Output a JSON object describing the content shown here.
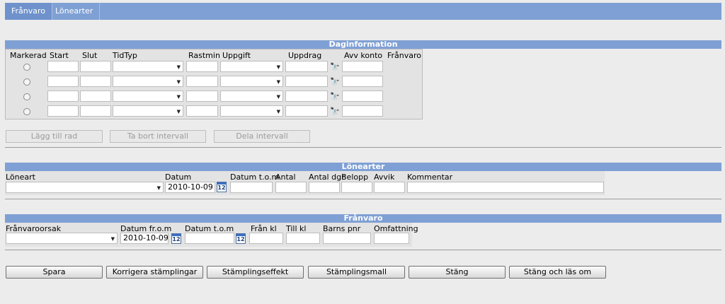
{
  "tabs": [
    "Frånvaro",
    "Lönearter"
  ],
  "daginfo": {
    "title": "Daginformation",
    "headers": [
      "Markerad",
      "Start",
      "Slut",
      "TidTyp",
      "Rastmin",
      "Uppgift",
      "Uppdrag",
      "Avv konto",
      "Frånvaro"
    ],
    "row_count": 4,
    "buttons": [
      "Lägg till rad",
      "Ta bort intervall",
      "Dela intervall"
    ]
  },
  "lonearter": {
    "title": "Lönearter",
    "headers": [
      "Löneart",
      "Datum",
      "Datum t.o.m",
      "Antal",
      "Antal dgr",
      "Belopp",
      "Avvik",
      "Kommentar"
    ],
    "datum_value": "2010-10-09",
    "calendar_label": "12"
  },
  "franvaro": {
    "title": "Frånvaro",
    "headers": [
      "Frånvaroorsak",
      "Datum fr.o.m",
      "Datum t.o.m",
      "Från kl",
      "Till kl",
      "Barns pnr",
      "Omfattning"
    ],
    "datum_from_value": "2010-10-09",
    "calendar_label": "12"
  },
  "actions": [
    "Spara",
    "Korrigera stämplingar",
    "Stämplingseffekt",
    "Stämplingsmall",
    "Stäng",
    "Stäng och läs om"
  ]
}
